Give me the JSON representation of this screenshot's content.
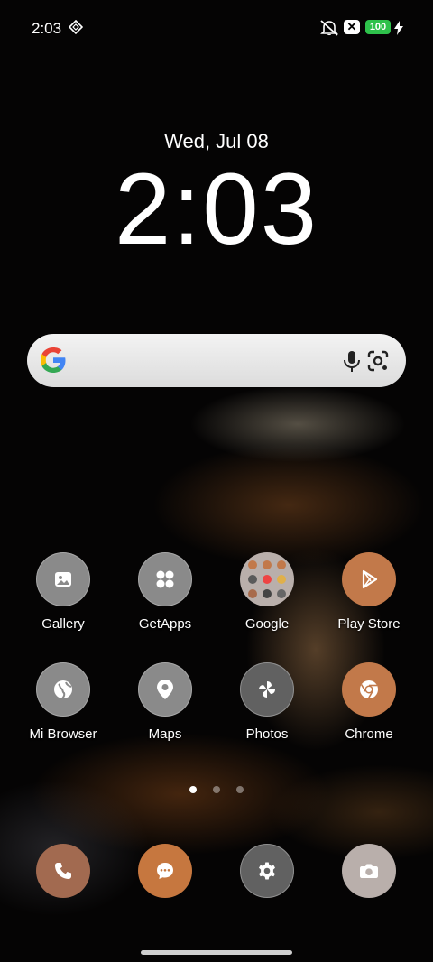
{
  "status_bar": {
    "time": "2:03",
    "battery": "100",
    "icons": [
      "network-icon",
      "mute-icon",
      "x-notification-icon",
      "battery-icon",
      "charging-bolt-icon"
    ],
    "battery_color": "#2ec14b"
  },
  "lockscreen": {
    "date": "Wed, Jul 08",
    "clock": "2:03"
  },
  "search_bar": {
    "icons": [
      "google-logo",
      "mic-icon",
      "lens-icon"
    ]
  },
  "apps": {
    "row1": [
      {
        "label": "Gallery",
        "icon": "gallery-icon"
      },
      {
        "label": "GetApps",
        "icon": "getapps-icon"
      },
      {
        "label": "Google",
        "icon": "folder-icon"
      },
      {
        "label": "Play Store",
        "icon": "play-store-icon"
      }
    ],
    "row2": [
      {
        "label": "Mi Browser",
        "icon": "globe-icon"
      },
      {
        "label": "Maps",
        "icon": "map-pin-icon"
      },
      {
        "label": "Photos",
        "icon": "pinwheel-icon"
      },
      {
        "label": "Chrome",
        "icon": "chrome-icon"
      }
    ]
  },
  "dock": [
    "phone-icon",
    "messages-icon",
    "settings-icon",
    "camera-icon"
  ],
  "pages": {
    "count": 3,
    "active": 1
  },
  "colors": {
    "accent_orange": "#c2794a",
    "search_bg": "#e8e8e8"
  }
}
